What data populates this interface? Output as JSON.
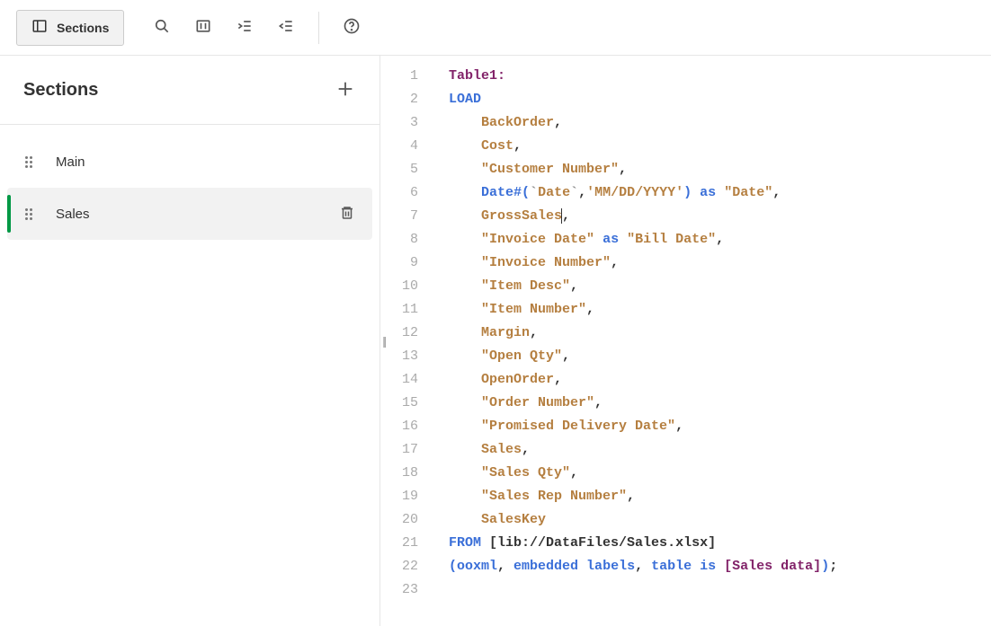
{
  "toolbar": {
    "sections_label": "Sections"
  },
  "sidebar": {
    "title": "Sections",
    "items": [
      {
        "label": "Main",
        "active": false
      },
      {
        "label": "Sales",
        "active": true
      }
    ]
  },
  "editor": {
    "lines": [
      [
        {
          "t": "label",
          "v": "Table1:"
        }
      ],
      [
        {
          "t": "kw",
          "v": "LOAD"
        }
      ],
      [
        {
          "t": "indent",
          "v": "    "
        },
        {
          "t": "field",
          "v": "BackOrder"
        },
        {
          "t": "punct",
          "v": ","
        }
      ],
      [
        {
          "t": "indent",
          "v": "    "
        },
        {
          "t": "field",
          "v": "Cost"
        },
        {
          "t": "punct",
          "v": ","
        }
      ],
      [
        {
          "t": "indent",
          "v": "    "
        },
        {
          "t": "str",
          "v": "\"Customer Number\""
        },
        {
          "t": "punct",
          "v": ","
        }
      ],
      [
        {
          "t": "indent",
          "v": "    "
        },
        {
          "t": "func",
          "v": "Date#"
        },
        {
          "t": "paren",
          "v": "("
        },
        {
          "t": "backtick",
          "v": "`"
        },
        {
          "t": "field",
          "v": "Date"
        },
        {
          "t": "backtick",
          "v": "`"
        },
        {
          "t": "punct",
          "v": ","
        },
        {
          "t": "quoted",
          "v": "'MM/DD/YYYY'"
        },
        {
          "t": "paren",
          "v": ")"
        },
        {
          "t": "plain",
          "v": " "
        },
        {
          "t": "as",
          "v": "as"
        },
        {
          "t": "plain",
          "v": " "
        },
        {
          "t": "str",
          "v": "\"Date\""
        },
        {
          "t": "punct",
          "v": ","
        }
      ],
      [
        {
          "t": "indent",
          "v": "    "
        },
        {
          "t": "field",
          "v": "GrossSales"
        },
        {
          "t": "cursor",
          "v": ""
        },
        {
          "t": "punct",
          "v": ","
        }
      ],
      [
        {
          "t": "indent",
          "v": "    "
        },
        {
          "t": "str",
          "v": "\"Invoice Date\""
        },
        {
          "t": "plain",
          "v": " "
        },
        {
          "t": "as",
          "v": "as"
        },
        {
          "t": "plain",
          "v": " "
        },
        {
          "t": "str",
          "v": "\"Bill Date\""
        },
        {
          "t": "punct",
          "v": ","
        }
      ],
      [
        {
          "t": "indent",
          "v": "    "
        },
        {
          "t": "str",
          "v": "\"Invoice Number\""
        },
        {
          "t": "punct",
          "v": ","
        }
      ],
      [
        {
          "t": "indent",
          "v": "    "
        },
        {
          "t": "str",
          "v": "\"Item Desc\""
        },
        {
          "t": "punct",
          "v": ","
        }
      ],
      [
        {
          "t": "indent",
          "v": "    "
        },
        {
          "t": "str",
          "v": "\"Item Number\""
        },
        {
          "t": "punct",
          "v": ","
        }
      ],
      [
        {
          "t": "indent",
          "v": "    "
        },
        {
          "t": "field",
          "v": "Margin"
        },
        {
          "t": "punct",
          "v": ","
        }
      ],
      [
        {
          "t": "indent",
          "v": "    "
        },
        {
          "t": "str",
          "v": "\"Open Qty\""
        },
        {
          "t": "punct",
          "v": ","
        }
      ],
      [
        {
          "t": "indent",
          "v": "    "
        },
        {
          "t": "field",
          "v": "OpenOrder"
        },
        {
          "t": "punct",
          "v": ","
        }
      ],
      [
        {
          "t": "indent",
          "v": "    "
        },
        {
          "t": "str",
          "v": "\"Order Number\""
        },
        {
          "t": "punct",
          "v": ","
        }
      ],
      [
        {
          "t": "indent",
          "v": "    "
        },
        {
          "t": "str",
          "v": "\"Promised Delivery Date\""
        },
        {
          "t": "punct",
          "v": ","
        }
      ],
      [
        {
          "t": "indent",
          "v": "    "
        },
        {
          "t": "field",
          "v": "Sales"
        },
        {
          "t": "punct",
          "v": ","
        }
      ],
      [
        {
          "t": "indent",
          "v": "    "
        },
        {
          "t": "str",
          "v": "\"Sales Qty\""
        },
        {
          "t": "punct",
          "v": ","
        }
      ],
      [
        {
          "t": "indent",
          "v": "    "
        },
        {
          "t": "str",
          "v": "\"Sales Rep Number\""
        },
        {
          "t": "punct",
          "v": ","
        }
      ],
      [
        {
          "t": "indent",
          "v": "    "
        },
        {
          "t": "field",
          "v": "SalesKey"
        }
      ],
      [
        {
          "t": "kw",
          "v": "FROM"
        },
        {
          "t": "plain",
          "v": " "
        },
        {
          "t": "path",
          "v": "[lib://DataFiles/Sales.xlsx]"
        }
      ],
      [
        {
          "t": "paren",
          "v": "("
        },
        {
          "t": "kw",
          "v": "ooxml"
        },
        {
          "t": "punct",
          "v": ", "
        },
        {
          "t": "kw",
          "v": "embedded labels"
        },
        {
          "t": "punct",
          "v": ", "
        },
        {
          "t": "kw",
          "v": "table"
        },
        {
          "t": "plain",
          "v": " "
        },
        {
          "t": "is",
          "v": "is"
        },
        {
          "t": "plain",
          "v": " "
        },
        {
          "t": "table",
          "v": "[Sales data]"
        },
        {
          "t": "paren",
          "v": ")"
        },
        {
          "t": "punct",
          "v": ";"
        }
      ],
      []
    ]
  }
}
